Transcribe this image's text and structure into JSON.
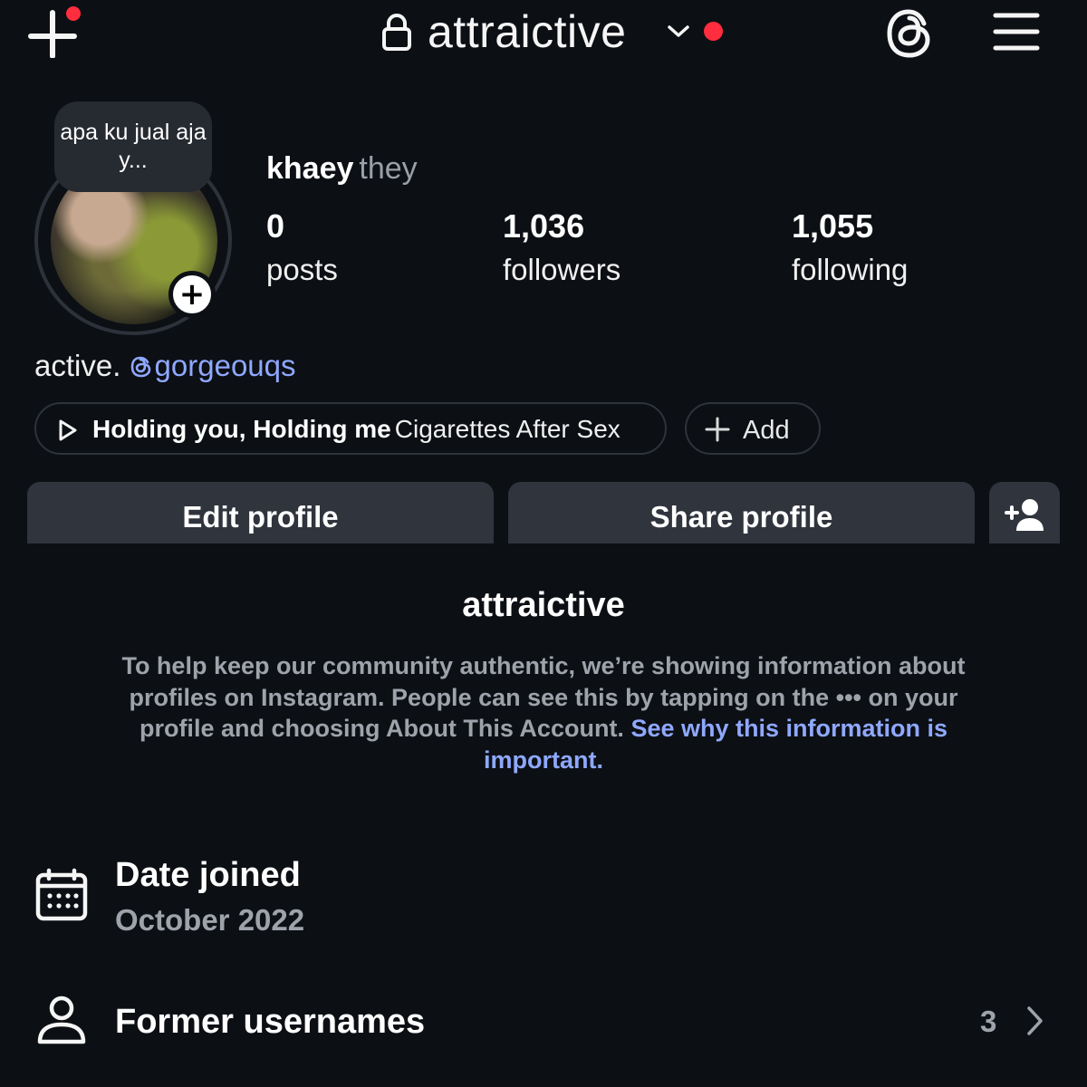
{
  "header": {
    "account_name": "attraictive"
  },
  "profile": {
    "note": "apa ku jual aja y...",
    "display_name": "khaey",
    "pronouns": "they",
    "stats": [
      {
        "value": "0",
        "label": "posts"
      },
      {
        "value": "1,036",
        "label": "followers"
      },
      {
        "value": "1,055",
        "label": "following"
      }
    ],
    "bio_text": "active.",
    "bio_link": "gorgeouqs",
    "music": {
      "song": "Holding you, Holding me",
      "artist": "Cigarettes After Sex"
    },
    "add_label": "Add"
  },
  "buttons": {
    "edit": "Edit profile",
    "share": "Share profile"
  },
  "about": {
    "title": "attraictive",
    "description": "To help keep our community authentic, we’re showing information about profiles on Instagram. People can see this by tapping on the ••• on your profile and choosing About This Account.",
    "link": "See why this information is important."
  },
  "rows": {
    "date_label": "Date joined",
    "date_value": "October 2022",
    "former_label": "Former usernames",
    "former_count": "3"
  },
  "icons": [
    "plus-icon",
    "lock-icon",
    "chevron-down-icon",
    "threads-icon",
    "menu-icon",
    "play-icon",
    "person-add-icon",
    "calendar-icon",
    "person-icon",
    "chevron-right-icon"
  ],
  "colors": {
    "background": "#0c0f14",
    "link": "#8fa8ff",
    "notification": "#ff2d3d",
    "button": "#2f343d"
  }
}
